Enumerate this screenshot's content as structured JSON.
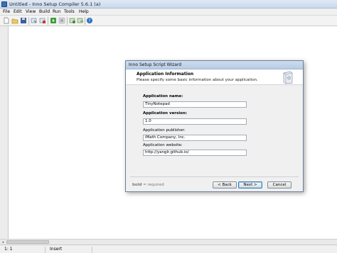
{
  "window": {
    "title": "Untitled - Inno Setup Compiler 5.6.1 (a)"
  },
  "menu": {
    "items": [
      "File",
      "Edit",
      "View",
      "Build",
      "Run",
      "Tools",
      "Help"
    ]
  },
  "toolbar": {
    "buttons": [
      "new-file-icon",
      "open-folder-icon",
      "save-icon",
      "compile-icon",
      "stop-compile-icon",
      "run-icon",
      "pause-icon",
      "target-setup-icon",
      "target-uninstall-icon",
      "help-icon"
    ]
  },
  "status": {
    "position": "1: 1",
    "mode": "Insert"
  },
  "dialog": {
    "title": "Inno Setup Script Wizard",
    "header_title": "Application Information",
    "header_subtitle": "Please specify some basic information about your application.",
    "fields": [
      {
        "label": "Application name:",
        "required": true,
        "value": "TinyNotepad"
      },
      {
        "label": "Application version:",
        "required": true,
        "value": "1.0"
      },
      {
        "label": "Application publisher:",
        "required": false,
        "value": "iMath Company, Inc."
      },
      {
        "label": "Application website:",
        "required": false,
        "value": "http://yanglr.github.io/"
      }
    ],
    "legend_bold": "bold",
    "legend_rest": " = required",
    "back_label": "< Back",
    "next_label": "Next >",
    "cancel_label": "Cancel"
  },
  "colors": {
    "title_gradient_top": "#dfe9f5",
    "default_button_border": "#3c7fb1"
  }
}
